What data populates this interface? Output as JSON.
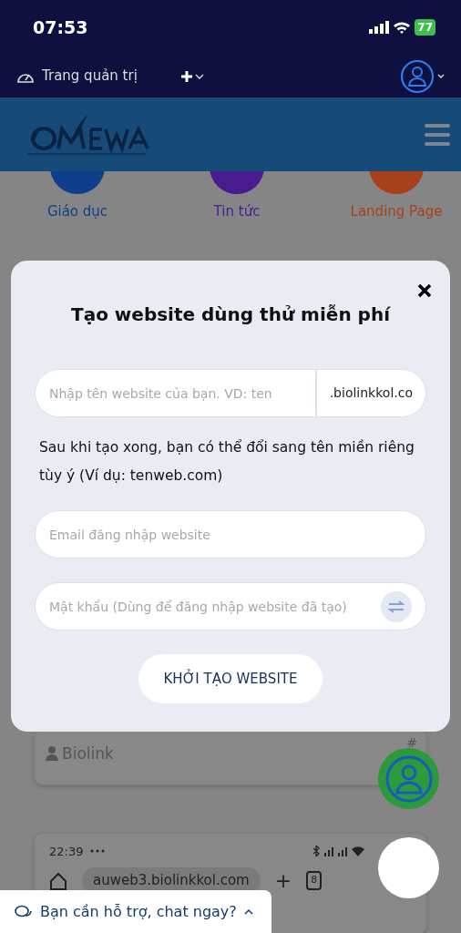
{
  "status_bar": {
    "time": "07:53",
    "battery": "77"
  },
  "admin_bar": {
    "label": "Trang quản trị"
  },
  "shortcuts": [
    {
      "label": "Giáo dục",
      "color": "#0f3f8c"
    },
    {
      "label": "Tin tức",
      "color": "#4a1a8f"
    },
    {
      "label": "Landing Page",
      "color": "#a8401e"
    }
  ],
  "cards": [
    {
      "title": "Biolink",
      "tag": "#"
    }
  ],
  "embedded_screenshot": {
    "time": "22:39",
    "address": "auweb3.biolinkkol.com",
    "add": "+",
    "tabs_count": "8"
  },
  "chat_bar": {
    "label": "Bạn cần hỗ trợ, chat ngay?"
  },
  "modal": {
    "title": "Tạo website dùng thử miễn phí",
    "name_field": {
      "placeholder": "Nhập tên website của bạn. VD: ten",
      "suffix": ".biolinkkol.co"
    },
    "help": "Sau khi tạo xong, bạn có thể đổi sang tên miền riêng tùy ý (Ví dụ: tenweb.com)",
    "email_field": {
      "placeholder": "Email đăng nhập website"
    },
    "password_field": {
      "placeholder": "Mật khẩu (Dùng để đăng nhập website đã tạo)"
    },
    "submit": "KHỞI TẠO WEBSITE"
  }
}
